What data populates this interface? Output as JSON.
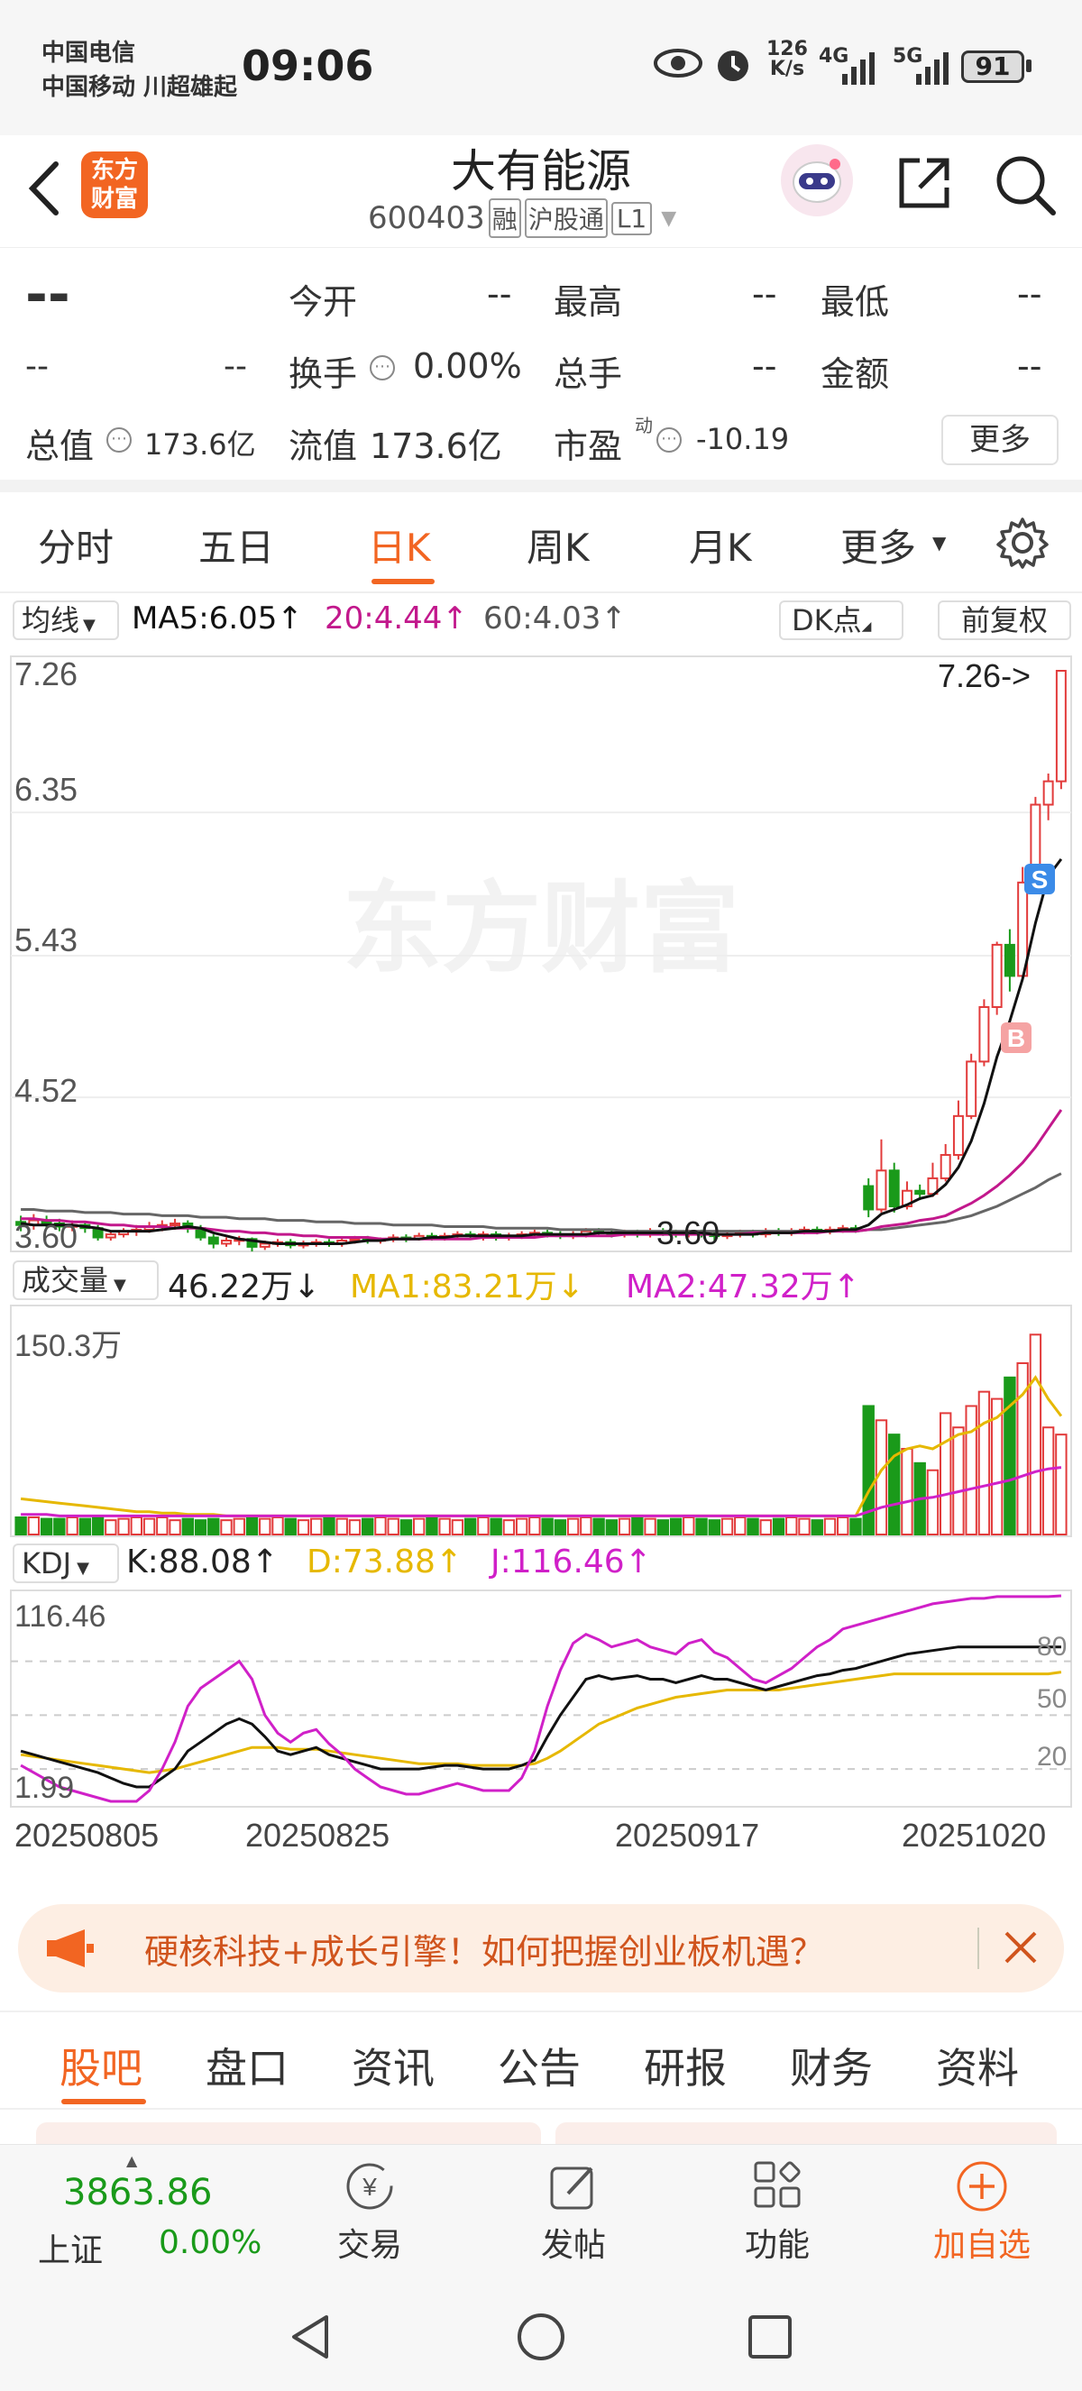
{
  "status_bar": {
    "carrier1": "中国电信",
    "carrier2": "中国移动 川超雄起",
    "time": "09:06",
    "net_speed_top": "126",
    "net_speed_unit": "K/s",
    "sig1": "4G",
    "sig2": "5G",
    "battery": "91"
  },
  "header": {
    "logo_line1": "东方",
    "logo_line2": "财富",
    "stock_name": "大有能源",
    "stock_code": "600403",
    "badge1": "融",
    "badge2": "沪股通",
    "badge3": "L1"
  },
  "quote": {
    "price": "--",
    "change1": "--",
    "change2": "--",
    "open_label": "今开",
    "open_value": "--",
    "high_label": "最高",
    "high_value": "--",
    "low_label": "最低",
    "low_value": "--",
    "turnover_label": "换手",
    "turnover_value": "0.00%",
    "volume_label": "总手",
    "volume_value": "--",
    "amount_label": "金额",
    "amount_value": "--",
    "total_cap_label": "总值",
    "total_cap_value": "173.6亿",
    "float_cap_label": "流值",
    "float_cap_value": "173.6亿",
    "pe_label": "市盈",
    "pe_sup": "动",
    "pe_value": "-10.19",
    "more_button": "更多"
  },
  "period_tabs": {
    "items": [
      "分时",
      "五日",
      "日K",
      "周K",
      "月K",
      "更多"
    ],
    "active": "日K"
  },
  "ma_bar": {
    "selector": "均线",
    "ma5": "MA5:6.05",
    "ma20": "20:4.44",
    "ma60": "60:4.03",
    "dk_button": "DK点",
    "fq_button": "前复权"
  },
  "price_chart": {
    "y_labels": [
      "7.26",
      "6.35",
      "5.43",
      "4.52",
      "3.60"
    ],
    "max_label": "7.26->",
    "min_label": "3.60",
    "watermark": "东方财富",
    "marker_b": "B",
    "marker_s": "S"
  },
  "volume_bar": {
    "selector": "成交量",
    "value": "46.22万",
    "ma1": "MA1:83.21万",
    "ma2": "MA2:47.32万",
    "max_label": "150.3万"
  },
  "kdj_bar": {
    "selector": "KDJ",
    "k": "K:88.08",
    "d": "D:73.88",
    "j": "J:116.46",
    "max_label": "116.46",
    "min_label": "1.99",
    "levels": [
      "80",
      "50",
      "20"
    ]
  },
  "dates": [
    "20250805",
    "20250825",
    "20250917",
    "20251020"
  ],
  "banner": {
    "text": "硬核科技+成长引擎！如何把握创业板机遇？"
  },
  "sub_tabs": {
    "items": [
      "股吧",
      "盘口",
      "资讯",
      "公告",
      "研报",
      "财务",
      "资料"
    ],
    "active": "股吧"
  },
  "bottom_bar": {
    "index_value": "3863.86",
    "index_name": "上证",
    "index_change": "0.00%",
    "items": [
      "交易",
      "发帖",
      "功能",
      "加自选"
    ]
  },
  "colors": {
    "up": "#e23b3b",
    "down": "#1a9a1a",
    "accent": "#f26522",
    "ma5": "#111111",
    "ma20": "#c2188c",
    "ma60": "#666666",
    "yellow": "#e6b800",
    "magenta": "#d020c8"
  },
  "chart_data": {
    "type": "candlestick",
    "title": "",
    "x_range": [
      "20250801",
      "20251022"
    ],
    "ylim": [
      3.6,
      7.26
    ],
    "candles": [
      [
        3.72,
        3.7,
        3.76,
        3.66
      ],
      [
        3.7,
        3.73,
        3.77,
        3.67
      ],
      [
        3.73,
        3.71,
        3.76,
        3.68
      ],
      [
        3.71,
        3.69,
        3.74,
        3.66
      ],
      [
        3.69,
        3.7,
        3.73,
        3.66
      ],
      [
        3.7,
        3.68,
        3.72,
        3.65
      ],
      [
        3.68,
        3.62,
        3.7,
        3.6
      ],
      [
        3.62,
        3.64,
        3.66,
        3.6
      ],
      [
        3.64,
        3.66,
        3.68,
        3.62
      ],
      [
        3.66,
        3.67,
        3.7,
        3.63
      ],
      [
        3.67,
        3.69,
        3.72,
        3.65
      ],
      [
        3.69,
        3.7,
        3.73,
        3.66
      ],
      [
        3.7,
        3.71,
        3.74,
        3.67
      ],
      [
        3.71,
        3.68,
        3.73,
        3.65
      ],
      [
        3.68,
        3.62,
        3.7,
        3.6
      ],
      [
        3.62,
        3.58,
        3.64,
        3.55
      ],
      [
        3.58,
        3.6,
        3.62,
        3.56
      ],
      [
        3.6,
        3.61,
        3.63,
        3.57
      ],
      [
        3.61,
        3.56,
        3.62,
        3.53
      ],
      [
        3.56,
        3.58,
        3.6,
        3.54
      ],
      [
        3.58,
        3.59,
        3.61,
        3.56
      ],
      [
        3.59,
        3.57,
        3.61,
        3.55
      ],
      [
        3.57,
        3.58,
        3.6,
        3.55
      ],
      [
        3.58,
        3.59,
        3.61,
        3.56
      ],
      [
        3.59,
        3.58,
        3.61,
        3.56
      ],
      [
        3.58,
        3.6,
        3.62,
        3.56
      ],
      [
        3.6,
        3.61,
        3.63,
        3.58
      ],
      [
        3.61,
        3.6,
        3.63,
        3.58
      ],
      [
        3.6,
        3.61,
        3.62,
        3.58
      ],
      [
        3.61,
        3.62,
        3.64,
        3.59
      ],
      [
        3.62,
        3.61,
        3.64,
        3.59
      ],
      [
        3.61,
        3.63,
        3.65,
        3.6
      ],
      [
        3.63,
        3.62,
        3.65,
        3.6
      ],
      [
        3.62,
        3.63,
        3.65,
        3.6
      ],
      [
        3.63,
        3.64,
        3.66,
        3.61
      ],
      [
        3.64,
        3.63,
        3.66,
        3.61
      ],
      [
        3.63,
        3.64,
        3.66,
        3.6
      ],
      [
        3.64,
        3.62,
        3.66,
        3.6
      ],
      [
        3.62,
        3.63,
        3.65,
        3.6
      ],
      [
        3.63,
        3.64,
        3.66,
        3.61
      ],
      [
        3.64,
        3.65,
        3.67,
        3.62
      ],
      [
        3.65,
        3.64,
        3.67,
        3.62
      ],
      [
        3.64,
        3.63,
        3.66,
        3.61
      ],
      [
        3.63,
        3.64,
        3.66,
        3.61
      ],
      [
        3.64,
        3.66,
        3.68,
        3.62
      ],
      [
        3.66,
        3.65,
        3.68,
        3.63
      ],
      [
        3.65,
        3.64,
        3.67,
        3.62
      ],
      [
        3.64,
        3.65,
        3.67,
        3.62
      ],
      [
        3.65,
        3.64,
        3.67,
        3.62
      ],
      [
        3.64,
        3.66,
        3.68,
        3.62
      ],
      [
        3.66,
        3.65,
        3.68,
        3.63
      ],
      [
        3.65,
        3.64,
        3.67,
        3.62
      ],
      [
        3.64,
        3.65,
        3.67,
        3.62
      ],
      [
        3.65,
        3.64,
        3.67,
        3.62
      ],
      [
        3.64,
        3.63,
        3.66,
        3.6
      ],
      [
        3.63,
        3.64,
        3.66,
        3.61
      ],
      [
        3.64,
        3.65,
        3.67,
        3.62
      ],
      [
        3.65,
        3.64,
        3.67,
        3.62
      ],
      [
        3.64,
        3.66,
        3.68,
        3.62
      ],
      [
        3.66,
        3.65,
        3.68,
        3.63
      ],
      [
        3.65,
        3.66,
        3.68,
        3.63
      ],
      [
        3.66,
        3.67,
        3.69,
        3.64
      ],
      [
        3.67,
        3.66,
        3.69,
        3.64
      ],
      [
        3.66,
        3.67,
        3.69,
        3.64
      ],
      [
        3.67,
        3.68,
        3.7,
        3.65
      ],
      [
        3.68,
        3.67,
        3.7,
        3.65
      ],
      [
        3.95,
        3.8,
        4.0,
        3.75
      ],
      [
        3.8,
        4.05,
        4.25,
        3.78
      ],
      [
        4.05,
        3.82,
        4.1,
        3.78
      ],
      [
        3.82,
        3.92,
        3.98,
        3.8
      ],
      [
        3.92,
        3.9,
        3.96,
        3.86
      ],
      [
        3.9,
        4.0,
        4.1,
        3.88
      ],
      [
        4.0,
        4.15,
        4.22,
        3.98
      ],
      [
        4.15,
        4.4,
        4.5,
        4.12
      ],
      [
        4.4,
        4.75,
        4.8,
        4.38
      ],
      [
        4.75,
        5.1,
        5.15,
        4.72
      ],
      [
        5.1,
        5.5,
        5.52,
        5.05
      ],
      [
        5.5,
        5.3,
        5.6,
        5.2
      ],
      [
        5.3,
        5.9,
        6.0,
        5.28
      ],
      [
        5.9,
        6.4,
        6.45,
        5.85
      ],
      [
        6.4,
        6.55,
        6.6,
        6.3
      ],
      [
        6.55,
        7.26,
        7.26,
        6.5
      ]
    ],
    "ma5": [
      3.71,
      3.7,
      3.7,
      3.7,
      3.7,
      3.69,
      3.68,
      3.66,
      3.66,
      3.66,
      3.66,
      3.67,
      3.68,
      3.69,
      3.68,
      3.65,
      3.63,
      3.61,
      3.6,
      3.59,
      3.58,
      3.58,
      3.58,
      3.58,
      3.58,
      3.58,
      3.59,
      3.6,
      3.6,
      3.61,
      3.61,
      3.61,
      3.62,
      3.62,
      3.63,
      3.63,
      3.63,
      3.63,
      3.63,
      3.63,
      3.64,
      3.64,
      3.64,
      3.64,
      3.64,
      3.65,
      3.65,
      3.65,
      3.65,
      3.65,
      3.65,
      3.65,
      3.65,
      3.65,
      3.64,
      3.64,
      3.64,
      3.64,
      3.65,
      3.65,
      3.65,
      3.66,
      3.66,
      3.66,
      3.67,
      3.67,
      3.7,
      3.77,
      3.8,
      3.83,
      3.87,
      3.89,
      3.96,
      4.07,
      4.24,
      4.48,
      4.78,
      5.01,
      5.28,
      5.64,
      5.94,
      6.05
    ],
    "ma20": [
      3.74,
      3.74,
      3.73,
      3.73,
      3.72,
      3.72,
      3.71,
      3.7,
      3.7,
      3.69,
      3.69,
      3.69,
      3.68,
      3.68,
      3.68,
      3.67,
      3.66,
      3.66,
      3.65,
      3.65,
      3.64,
      3.64,
      3.63,
      3.63,
      3.62,
      3.62,
      3.62,
      3.62,
      3.61,
      3.61,
      3.61,
      3.61,
      3.61,
      3.61,
      3.61,
      3.61,
      3.62,
      3.62,
      3.62,
      3.62,
      3.62,
      3.63,
      3.63,
      3.63,
      3.63,
      3.63,
      3.63,
      3.64,
      3.64,
      3.64,
      3.64,
      3.64,
      3.64,
      3.64,
      3.64,
      3.64,
      3.64,
      3.65,
      3.65,
      3.65,
      3.65,
      3.65,
      3.65,
      3.66,
      3.66,
      3.66,
      3.67,
      3.69,
      3.7,
      3.71,
      3.73,
      3.74,
      3.76,
      3.8,
      3.84,
      3.89,
      3.95,
      4.02,
      4.1,
      4.2,
      4.32,
      4.44
    ],
    "ma60": [
      3.8,
      3.8,
      3.79,
      3.79,
      3.79,
      3.78,
      3.78,
      3.78,
      3.77,
      3.77,
      3.77,
      3.76,
      3.76,
      3.76,
      3.75,
      3.75,
      3.75,
      3.74,
      3.74,
      3.74,
      3.73,
      3.73,
      3.73,
      3.72,
      3.72,
      3.72,
      3.71,
      3.71,
      3.71,
      3.7,
      3.7,
      3.7,
      3.7,
      3.69,
      3.69,
      3.69,
      3.69,
      3.68,
      3.68,
      3.68,
      3.68,
      3.68,
      3.67,
      3.67,
      3.67,
      3.67,
      3.67,
      3.66,
      3.66,
      3.66,
      3.66,
      3.66,
      3.66,
      3.66,
      3.66,
      3.66,
      3.66,
      3.66,
      3.66,
      3.66,
      3.66,
      3.66,
      3.66,
      3.66,
      3.66,
      3.66,
      3.67,
      3.67,
      3.68,
      3.69,
      3.7,
      3.71,
      3.72,
      3.74,
      3.76,
      3.79,
      3.82,
      3.86,
      3.9,
      3.94,
      3.99,
      4.03
    ],
    "volume": {
      "ylim": [
        0,
        150.3
      ],
      "unit": "万",
      "values": [
        12,
        12,
        11,
        11,
        12,
        11,
        12,
        10,
        11,
        12,
        11,
        12,
        10,
        11,
        10,
        11,
        10,
        11,
        12,
        11,
        12,
        11,
        10,
        11,
        12,
        11,
        10,
        11,
        12,
        11,
        10,
        11,
        12,
        11,
        10,
        11,
        12,
        11,
        10,
        11,
        12,
        11,
        10,
        11,
        12,
        11,
        10,
        11,
        12,
        11,
        10,
        11,
        12,
        11,
        10,
        11,
        12,
        11,
        10,
        11,
        12,
        11,
        10,
        11,
        12,
        11,
        90,
        80,
        70,
        60,
        50,
        45,
        85,
        75,
        90,
        100,
        95,
        110,
        120,
        140,
        75,
        70
      ],
      "ma1": [
        25,
        24,
        23,
        22,
        21,
        20,
        19,
        18,
        17,
        16,
        16,
        15,
        15,
        14,
        14,
        14,
        13,
        13,
        13,
        13,
        13,
        13,
        13,
        13,
        13,
        13,
        13,
        13,
        13,
        13,
        13,
        13,
        13,
        13,
        13,
        13,
        13,
        13,
        13,
        13,
        13,
        13,
        13,
        13,
        13,
        13,
        13,
        13,
        13,
        13,
        13,
        13,
        13,
        13,
        13,
        13,
        13,
        13,
        13,
        13,
        13,
        13,
        13,
        13,
        13,
        13,
        30,
        45,
        55,
        60,
        62,
        60,
        65,
        70,
        72,
        78,
        82,
        90,
        98,
        110,
        95,
        83
      ],
      "ma2": [
        14,
        14,
        14,
        13,
        13,
        13,
        13,
        13,
        13,
        13,
        13,
        13,
        13,
        13,
        13,
        13,
        13,
        13,
        13,
        13,
        13,
        13,
        13,
        13,
        13,
        13,
        13,
        13,
        13,
        13,
        13,
        13,
        13,
        13,
        13,
        13,
        13,
        13,
        13,
        13,
        13,
        13,
        13,
        13,
        13,
        13,
        13,
        13,
        13,
        13,
        13,
        13,
        13,
        13,
        13,
        13,
        13,
        13,
        13,
        13,
        13,
        13,
        13,
        13,
        13,
        13,
        16,
        19,
        21,
        23,
        25,
        26,
        28,
        30,
        32,
        34,
        36,
        38,
        41,
        44,
        46,
        47
      ]
    },
    "kdj": {
      "ylim": [
        1.99,
        116.46
      ],
      "k": [
        30,
        28,
        26,
        24,
        22,
        20,
        18,
        15,
        12,
        10,
        10,
        15,
        20,
        30,
        35,
        40,
        45,
        48,
        45,
        38,
        30,
        28,
        30,
        32,
        28,
        26,
        24,
        22,
        20,
        20,
        20,
        20,
        21,
        22,
        22,
        21,
        20,
        20,
        20,
        22,
        25,
        38,
        50,
        60,
        70,
        72,
        70,
        71,
        72,
        70,
        70,
        68,
        70,
        72,
        70,
        70,
        68,
        66,
        64,
        66,
        68,
        70,
        72,
        73,
        75,
        76,
        78,
        80,
        82,
        84,
        85,
        86,
        87,
        88,
        88,
        88,
        88,
        88,
        88,
        88,
        88,
        88
      ],
      "d": [
        28,
        27,
        26,
        25,
        24,
        23,
        22,
        21,
        20,
        19,
        18,
        19,
        20,
        22,
        24,
        26,
        28,
        30,
        32,
        32,
        32,
        31,
        31,
        31,
        30,
        29,
        28,
        27,
        26,
        25,
        24,
        23,
        23,
        23,
        23,
        22,
        22,
        22,
        22,
        22,
        23,
        26,
        30,
        35,
        40,
        45,
        48,
        51,
        54,
        56,
        58,
        60,
        61,
        62,
        63,
        64,
        64,
        64,
        64,
        64,
        65,
        66,
        67,
        68,
        69,
        70,
        71,
        72,
        73,
        73,
        73,
        73,
        73,
        73,
        73,
        73,
        73,
        73,
        73,
        73,
        73,
        74
      ],
      "j": [
        22,
        18,
        14,
        10,
        8,
        6,
        4,
        2,
        2,
        2,
        8,
        20,
        35,
        55,
        65,
        70,
        75,
        80,
        70,
        50,
        40,
        35,
        40,
        42,
        34,
        28,
        20,
        15,
        10,
        8,
        6,
        6,
        8,
        10,
        12,
        10,
        8,
        8,
        8,
        15,
        30,
        55,
        75,
        90,
        95,
        92,
        88,
        90,
        92,
        88,
        86,
        84,
        90,
        92,
        85,
        82,
        76,
        70,
        68,
        72,
        76,
        82,
        88,
        92,
        98,
        100,
        102,
        104,
        106,
        108,
        110,
        112,
        113,
        114,
        115,
        115,
        116,
        116,
        116,
        116,
        116,
        116.46
      ]
    }
  }
}
